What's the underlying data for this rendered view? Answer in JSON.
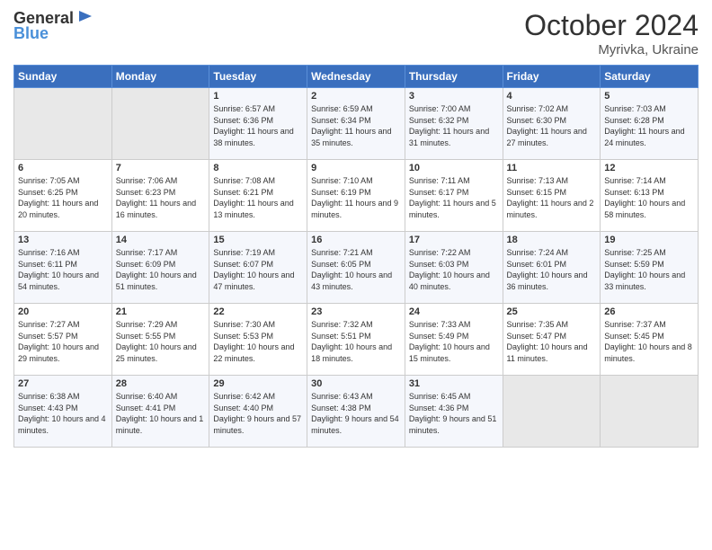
{
  "header": {
    "logo_general": "General",
    "logo_blue": "Blue",
    "title": "October 2024",
    "subtitle": "Myrivka, Ukraine"
  },
  "weekdays": [
    "Sunday",
    "Monday",
    "Tuesday",
    "Wednesday",
    "Thursday",
    "Friday",
    "Saturday"
  ],
  "weeks": [
    [
      {
        "day": "",
        "sunrise": "",
        "sunset": "",
        "daylight": "",
        "empty": true
      },
      {
        "day": "",
        "sunrise": "",
        "sunset": "",
        "daylight": "",
        "empty": true
      },
      {
        "day": "1",
        "sunrise": "Sunrise: 6:57 AM",
        "sunset": "Sunset: 6:36 PM",
        "daylight": "Daylight: 11 hours and 38 minutes."
      },
      {
        "day": "2",
        "sunrise": "Sunrise: 6:59 AM",
        "sunset": "Sunset: 6:34 PM",
        "daylight": "Daylight: 11 hours and 35 minutes."
      },
      {
        "day": "3",
        "sunrise": "Sunrise: 7:00 AM",
        "sunset": "Sunset: 6:32 PM",
        "daylight": "Daylight: 11 hours and 31 minutes."
      },
      {
        "day": "4",
        "sunrise": "Sunrise: 7:02 AM",
        "sunset": "Sunset: 6:30 PM",
        "daylight": "Daylight: 11 hours and 27 minutes."
      },
      {
        "day": "5",
        "sunrise": "Sunrise: 7:03 AM",
        "sunset": "Sunset: 6:28 PM",
        "daylight": "Daylight: 11 hours and 24 minutes."
      }
    ],
    [
      {
        "day": "6",
        "sunrise": "Sunrise: 7:05 AM",
        "sunset": "Sunset: 6:25 PM",
        "daylight": "Daylight: 11 hours and 20 minutes."
      },
      {
        "day": "7",
        "sunrise": "Sunrise: 7:06 AM",
        "sunset": "Sunset: 6:23 PM",
        "daylight": "Daylight: 11 hours and 16 minutes."
      },
      {
        "day": "8",
        "sunrise": "Sunrise: 7:08 AM",
        "sunset": "Sunset: 6:21 PM",
        "daylight": "Daylight: 11 hours and 13 minutes."
      },
      {
        "day": "9",
        "sunrise": "Sunrise: 7:10 AM",
        "sunset": "Sunset: 6:19 PM",
        "daylight": "Daylight: 11 hours and 9 minutes."
      },
      {
        "day": "10",
        "sunrise": "Sunrise: 7:11 AM",
        "sunset": "Sunset: 6:17 PM",
        "daylight": "Daylight: 11 hours and 5 minutes."
      },
      {
        "day": "11",
        "sunrise": "Sunrise: 7:13 AM",
        "sunset": "Sunset: 6:15 PM",
        "daylight": "Daylight: 11 hours and 2 minutes."
      },
      {
        "day": "12",
        "sunrise": "Sunrise: 7:14 AM",
        "sunset": "Sunset: 6:13 PM",
        "daylight": "Daylight: 10 hours and 58 minutes."
      }
    ],
    [
      {
        "day": "13",
        "sunrise": "Sunrise: 7:16 AM",
        "sunset": "Sunset: 6:11 PM",
        "daylight": "Daylight: 10 hours and 54 minutes."
      },
      {
        "day": "14",
        "sunrise": "Sunrise: 7:17 AM",
        "sunset": "Sunset: 6:09 PM",
        "daylight": "Daylight: 10 hours and 51 minutes."
      },
      {
        "day": "15",
        "sunrise": "Sunrise: 7:19 AM",
        "sunset": "Sunset: 6:07 PM",
        "daylight": "Daylight: 10 hours and 47 minutes."
      },
      {
        "day": "16",
        "sunrise": "Sunrise: 7:21 AM",
        "sunset": "Sunset: 6:05 PM",
        "daylight": "Daylight: 10 hours and 43 minutes."
      },
      {
        "day": "17",
        "sunrise": "Sunrise: 7:22 AM",
        "sunset": "Sunset: 6:03 PM",
        "daylight": "Daylight: 10 hours and 40 minutes."
      },
      {
        "day": "18",
        "sunrise": "Sunrise: 7:24 AM",
        "sunset": "Sunset: 6:01 PM",
        "daylight": "Daylight: 10 hours and 36 minutes."
      },
      {
        "day": "19",
        "sunrise": "Sunrise: 7:25 AM",
        "sunset": "Sunset: 5:59 PM",
        "daylight": "Daylight: 10 hours and 33 minutes."
      }
    ],
    [
      {
        "day": "20",
        "sunrise": "Sunrise: 7:27 AM",
        "sunset": "Sunset: 5:57 PM",
        "daylight": "Daylight: 10 hours and 29 minutes."
      },
      {
        "day": "21",
        "sunrise": "Sunrise: 7:29 AM",
        "sunset": "Sunset: 5:55 PM",
        "daylight": "Daylight: 10 hours and 25 minutes."
      },
      {
        "day": "22",
        "sunrise": "Sunrise: 7:30 AM",
        "sunset": "Sunset: 5:53 PM",
        "daylight": "Daylight: 10 hours and 22 minutes."
      },
      {
        "day": "23",
        "sunrise": "Sunrise: 7:32 AM",
        "sunset": "Sunset: 5:51 PM",
        "daylight": "Daylight: 10 hours and 18 minutes."
      },
      {
        "day": "24",
        "sunrise": "Sunrise: 7:33 AM",
        "sunset": "Sunset: 5:49 PM",
        "daylight": "Daylight: 10 hours and 15 minutes."
      },
      {
        "day": "25",
        "sunrise": "Sunrise: 7:35 AM",
        "sunset": "Sunset: 5:47 PM",
        "daylight": "Daylight: 10 hours and 11 minutes."
      },
      {
        "day": "26",
        "sunrise": "Sunrise: 7:37 AM",
        "sunset": "Sunset: 5:45 PM",
        "daylight": "Daylight: 10 hours and 8 minutes."
      }
    ],
    [
      {
        "day": "27",
        "sunrise": "Sunrise: 6:38 AM",
        "sunset": "Sunset: 4:43 PM",
        "daylight": "Daylight: 10 hours and 4 minutes."
      },
      {
        "day": "28",
        "sunrise": "Sunrise: 6:40 AM",
        "sunset": "Sunset: 4:41 PM",
        "daylight": "Daylight: 10 hours and 1 minute."
      },
      {
        "day": "29",
        "sunrise": "Sunrise: 6:42 AM",
        "sunset": "Sunset: 4:40 PM",
        "daylight": "Daylight: 9 hours and 57 minutes."
      },
      {
        "day": "30",
        "sunrise": "Sunrise: 6:43 AM",
        "sunset": "Sunset: 4:38 PM",
        "daylight": "Daylight: 9 hours and 54 minutes."
      },
      {
        "day": "31",
        "sunrise": "Sunrise: 6:45 AM",
        "sunset": "Sunset: 4:36 PM",
        "daylight": "Daylight: 9 hours and 51 minutes."
      },
      {
        "day": "",
        "sunrise": "",
        "sunset": "",
        "daylight": "",
        "empty": true
      },
      {
        "day": "",
        "sunrise": "",
        "sunset": "",
        "daylight": "",
        "empty": true
      }
    ]
  ]
}
